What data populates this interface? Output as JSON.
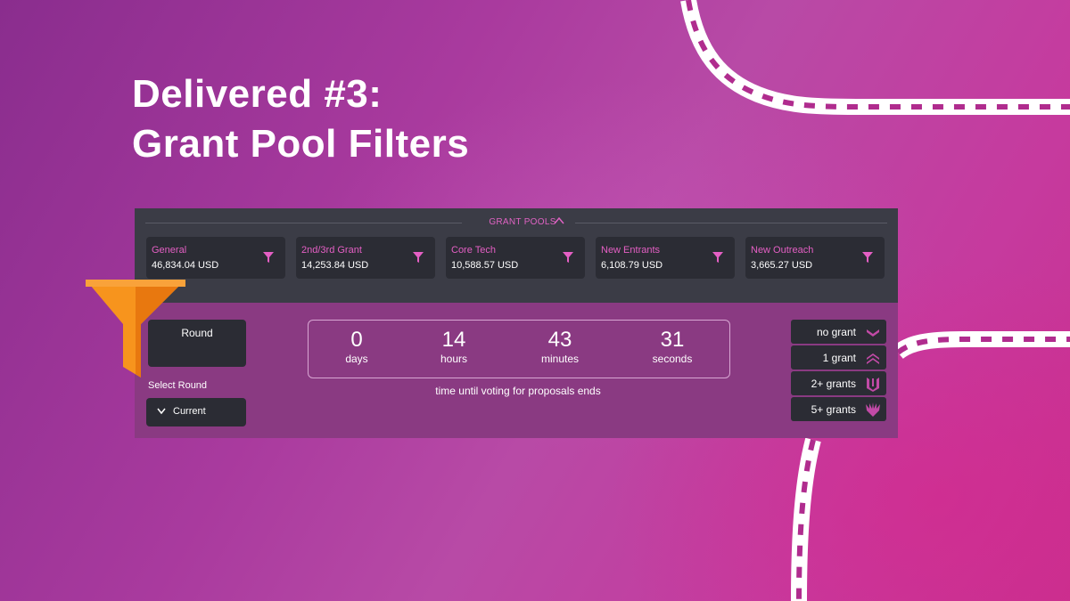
{
  "headline": {
    "line1": "Delivered #3:",
    "line2": "Grant Pool Filters"
  },
  "grant_pools": {
    "title": "GRANT POOLS",
    "pools": [
      {
        "name": "General",
        "amount": "46,834.04 USD"
      },
      {
        "name": "2nd/3rd Grant",
        "amount": "14,253.84 USD"
      },
      {
        "name": "Core Tech",
        "amount": "10,588.57 USD"
      },
      {
        "name": "New Entrants",
        "amount": "6,108.79 USD"
      },
      {
        "name": "New Outreach",
        "amount": "3,665.27 USD"
      }
    ]
  },
  "round": {
    "label": "Round",
    "select_label": "Select Round",
    "selected": "Current"
  },
  "countdown": {
    "days": {
      "value": "0",
      "label": "days"
    },
    "hours": {
      "value": "14",
      "label": "hours"
    },
    "minutes": {
      "value": "43",
      "label": "minutes"
    },
    "seconds": {
      "value": "31",
      "label": "seconds"
    },
    "caption": "time until voting for proposals ends"
  },
  "grant_filters": [
    {
      "label": "no grant",
      "icon": "chevron-down-icon"
    },
    {
      "label": "1 grant",
      "icon": "double-chevron-up-icon"
    },
    {
      "label": "2+ grants",
      "icon": "triple-rank-icon"
    },
    {
      "label": "5+ grants",
      "icon": "burst-rank-icon"
    }
  ],
  "colors": {
    "accent_pink": "#e45fc4",
    "panel_dark": "#3b3c46",
    "card_dark": "#2b2c34",
    "funnel_orange": "#f7941d"
  }
}
